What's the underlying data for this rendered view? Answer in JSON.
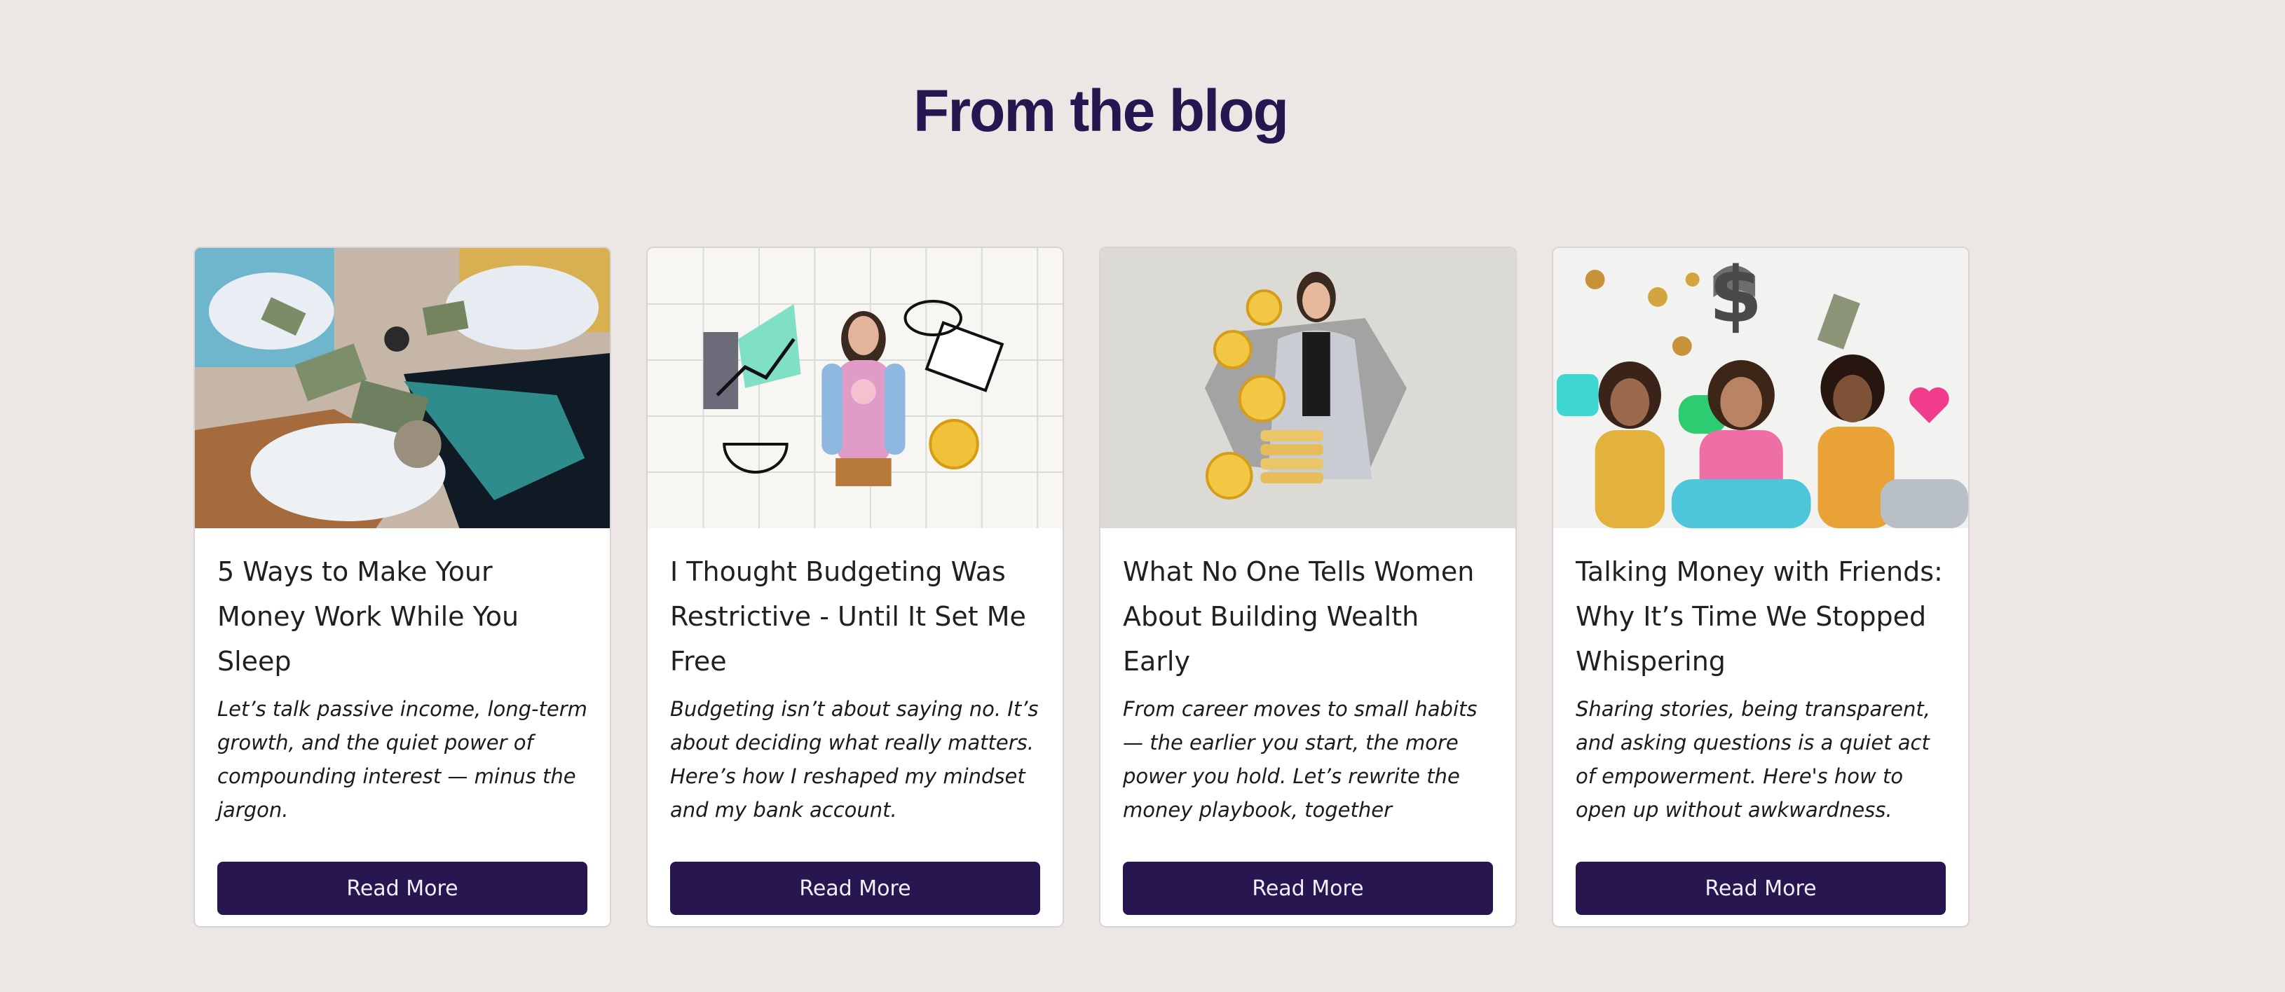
{
  "section": {
    "title": "From the blog"
  },
  "posts": [
    {
      "title": "5 Ways to Make Your Money Work While You Sleep",
      "excerpt": "Let’s talk passive income, long-term growth, and the quiet power of compounding interest — minus the jargon.",
      "cta": "Read More",
      "image_icon": "money-collage-image"
    },
    {
      "title": "I Thought Budgeting Was Restrictive - Until It Set Me Free",
      "excerpt": "Budgeting isn’t about saying no. It’s about deciding what really matters. Here’s how I reshaped my mindset and my bank account.",
      "cta": "Read More",
      "image_icon": "budgeting-woman-image"
    },
    {
      "title": "What No One Tells Women About Building Wealth Early",
      "excerpt": "From career moves to small habits — the earlier you start, the more power you hold. Let’s rewrite the money playbook, together",
      "cta": "Read More",
      "image_icon": "businesswoman-coins-image"
    },
    {
      "title": "Talking Money with Friends: Why It’s Time We Stopped Whispering",
      "excerpt": "Sharing stories, being transparent, and asking questions is a quiet act of empowerment. Here's how to open up without awkwardness.",
      "cta": "Read More",
      "image_icon": "friends-phones-image"
    }
  ],
  "colors": {
    "background": "#ece7e4",
    "heading": "#271750",
    "button": "#27164f",
    "button_text": "#f2f0f7",
    "card": "#ffffff"
  }
}
